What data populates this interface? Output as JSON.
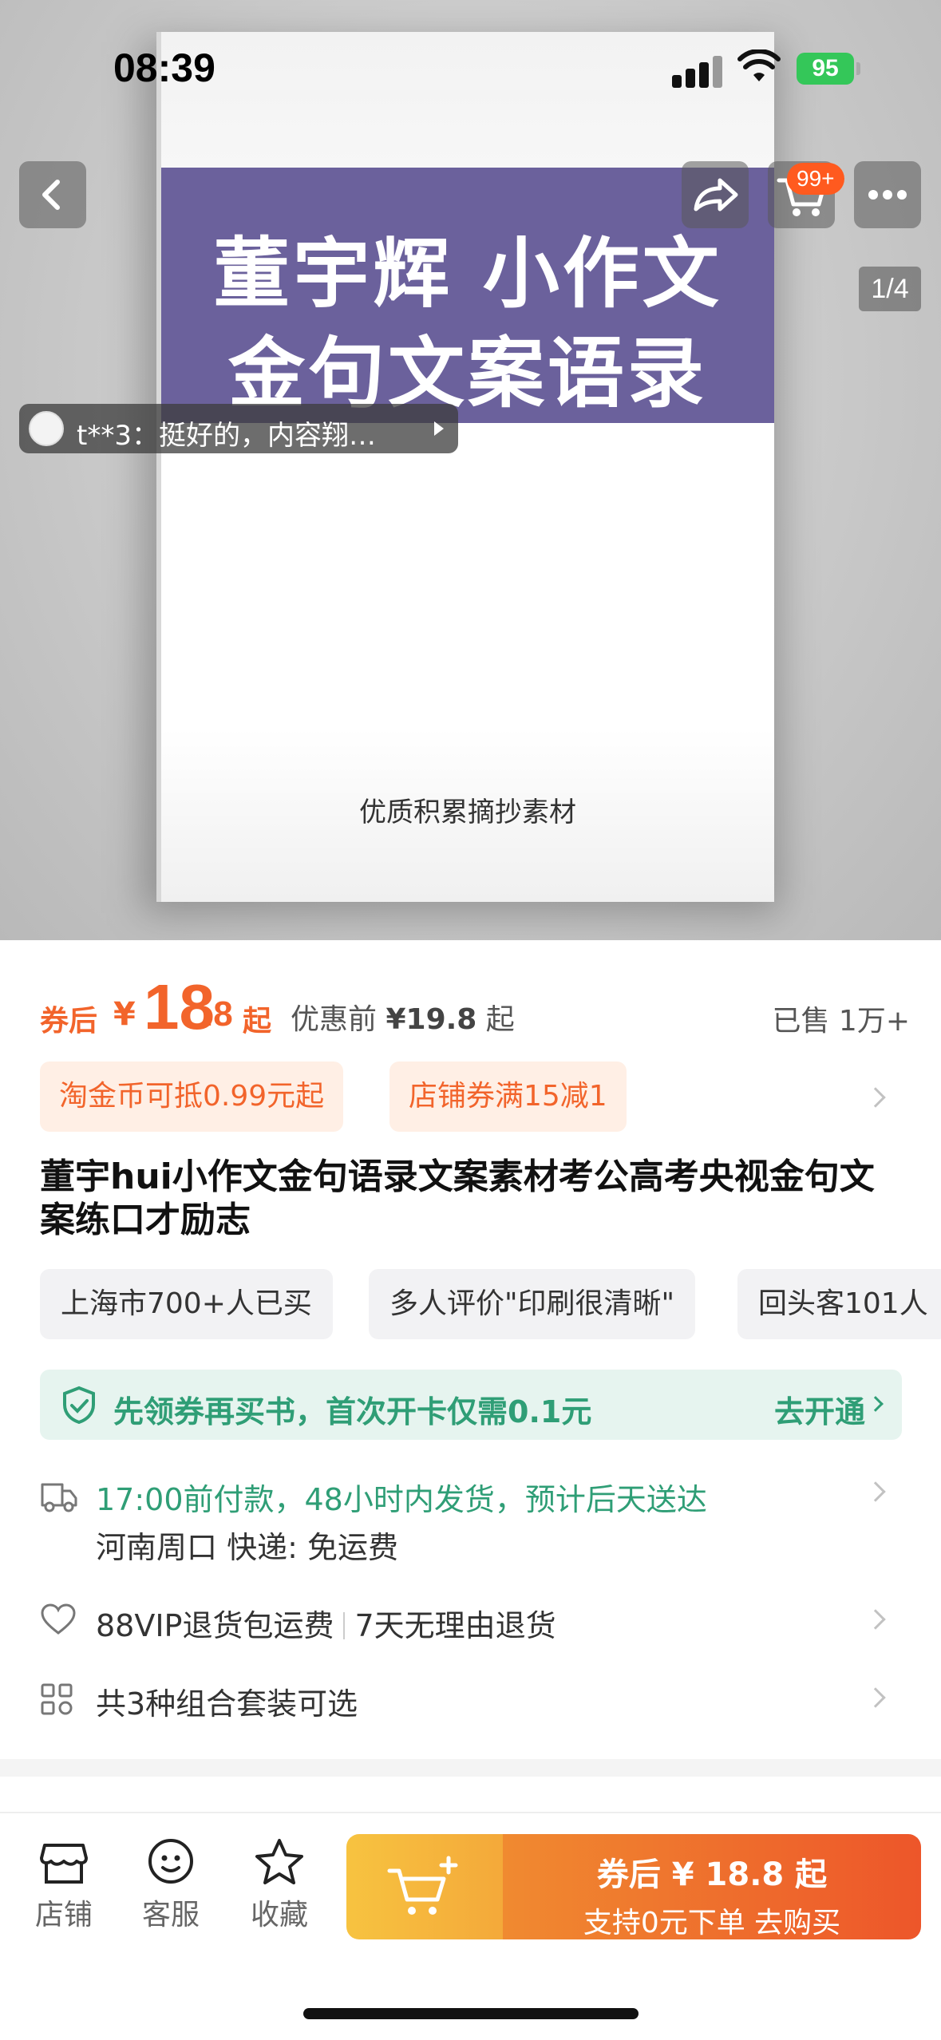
{
  "status_bar": {
    "time": "08:39",
    "battery": "95"
  },
  "hero": {
    "book_title_line1": "董宇辉 小作文",
    "book_title_line2": "金句文案语录",
    "book_subtitle": "优质积累摘抄素材",
    "cart_badge": "99+",
    "page_indicator": "1/4",
    "review_snippet": "t**3：挺好的，内容翔…"
  },
  "price": {
    "label": "券后",
    "currency": "¥",
    "integer": "18",
    "decimal": ".8",
    "suffix": "起",
    "before_label": "优惠前",
    "before_value": "¥19.8",
    "before_suffix": "起",
    "sold": "已售 1万+"
  },
  "coupons": [
    "淘金币可抵0.99元起",
    "店铺券满15减1"
  ],
  "title": "董宇hui小作文金句语录文案素材考公高考央视金句文案练口才励志",
  "tags": [
    "上海市700+人已买",
    "多人评价\"印刷很清晰\"",
    "回头客101人"
  ],
  "promo": {
    "text": "先领券再买书，首次开卡仅需0.1元",
    "action": "去开通"
  },
  "shipping": {
    "line1": "17:00前付款，48小时内发货，预计后天送达",
    "line2": "河南周口  快递: 免运费"
  },
  "returns": {
    "part1": "88VIP退货包运费",
    "part2": "7天无理由退货"
  },
  "combo": "共3种组合套装可选",
  "bottom_bar": {
    "shop": "店铺",
    "service": "客服",
    "favorite": "收藏",
    "buy_line1": "券后 ¥ 18.8 起",
    "buy_line2": "支持0元下单  去购买"
  },
  "colors": {
    "accent": "#f2642b",
    "green": "#2f9e76",
    "book_band": "#6b619c"
  }
}
